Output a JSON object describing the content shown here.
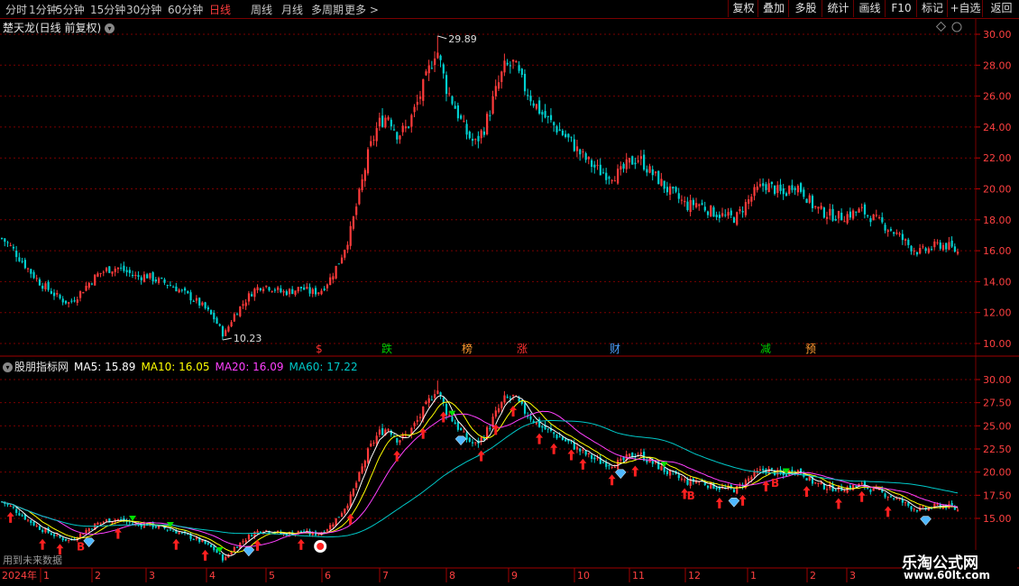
{
  "topbar": {
    "periods": [
      "分时",
      "1分钟",
      "5分钟",
      "15分钟",
      "30分钟",
      "60分钟",
      "日线",
      "周线",
      "月线",
      "多周期",
      "更多 >"
    ],
    "active_period": "日线",
    "right_buttons": [
      "复权",
      "叠加",
      "多股",
      "统计",
      "画线",
      "F10",
      "标记",
      "+自选",
      "返回"
    ]
  },
  "main_panel": {
    "title": "楚天龙(日线 前复权)",
    "high_label": "29.89",
    "low_label": "10.23",
    "y_ticks": [
      "30.00",
      "28.00",
      "26.00",
      "24.00",
      "22.00",
      "20.00",
      "18.00",
      "16.00",
      "14.00",
      "12.00",
      "10.00"
    ],
    "event_markers": [
      {
        "text": "$",
        "color": "#ff3030"
      },
      {
        "text": "跌",
        "color": "#00d000"
      },
      {
        "text": "榜",
        "color": "#ff9a30"
      },
      {
        "text": "涨",
        "color": "#ff3030"
      },
      {
        "text": "财",
        "color": "#4aa0ff"
      },
      {
        "text": "减",
        "color": "#00d000"
      },
      {
        "text": "预",
        "color": "#ff9a30"
      }
    ]
  },
  "indicator_panel": {
    "name": "股朋指标网",
    "ma5_label": "MA5: 15.89",
    "ma10_label": "MA10: 16.05",
    "ma20_label": "MA20: 16.09",
    "ma60_label": "MA60: 17.22",
    "y_ticks": [
      "30.00",
      "27.50",
      "25.00",
      "22.50",
      "20.00",
      "17.50",
      "15.00"
    ],
    "future_text": "用到未来数据",
    "b_label": "B"
  },
  "x_axis": {
    "labels": [
      "2024年",
      "1",
      "2",
      "3",
      "4",
      "5",
      "6",
      "7",
      "8",
      "9",
      "10",
      "11",
      "12",
      "1",
      "2",
      "3"
    ]
  },
  "colors": {
    "up": "#ff3b3b",
    "down": "#00d0d0",
    "ma5": "#ffffff",
    "ma10": "#ffff00",
    "ma20": "#ff40ff",
    "ma60": "#00c8c8",
    "grid": "#7a0000"
  },
  "watermark": {
    "cn": "乐淘公式网",
    "url": "www.60lt.com"
  },
  "chart_data": {
    "type": "candlestick",
    "x_labels": [
      "2024年",
      "1",
      "2",
      "3",
      "4",
      "5",
      "6",
      "7",
      "8",
      "9",
      "10",
      "11",
      "12",
      "1",
      "2",
      "3"
    ],
    "price_ylim": [
      10,
      30
    ],
    "close_trend": [
      16.8,
      16.2,
      15.4,
      14.6,
      13.9,
      13.4,
      12.9,
      12.6,
      13.2,
      13.9,
      14.5,
      14.8,
      14.9,
      14.6,
      14.3,
      14.4,
      14.1,
      13.9,
      13.6,
      13.2,
      12.8,
      12.3,
      11.6,
      10.5,
      11.8,
      12.6,
      13.4,
      13.8,
      13.6,
      13.3,
      13.4,
      13.6,
      13.3,
      13.4,
      14.2,
      15.4,
      17.0,
      19.6,
      22.4,
      24.2,
      24.8,
      23.5,
      24.0,
      25.5,
      27.2,
      29.2,
      26.6,
      25.2,
      23.7,
      22.9,
      24.0,
      26.0,
      27.8,
      28.1,
      26.7,
      25.7,
      24.8,
      24.2,
      23.6,
      23.0,
      22.2,
      21.6,
      21.1,
      20.9,
      21.0,
      21.7,
      22.0,
      21.2,
      20.6,
      19.9,
      19.4,
      18.9,
      19.1,
      18.7,
      18.4,
      18.2,
      18.1,
      19.0,
      19.8,
      20.3,
      20.0,
      19.6,
      20.4,
      19.8,
      18.9,
      18.5,
      18.3,
      18.2,
      18.4,
      18.6,
      18.2,
      17.8,
      17.4,
      16.9,
      16.3,
      15.9,
      16.1,
      16.4,
      16.3,
      15.9
    ],
    "ma_values": {
      "MA5": 15.89,
      "MA10": 16.05,
      "MA20": 16.09,
      "MA60": 17.22
    }
  }
}
